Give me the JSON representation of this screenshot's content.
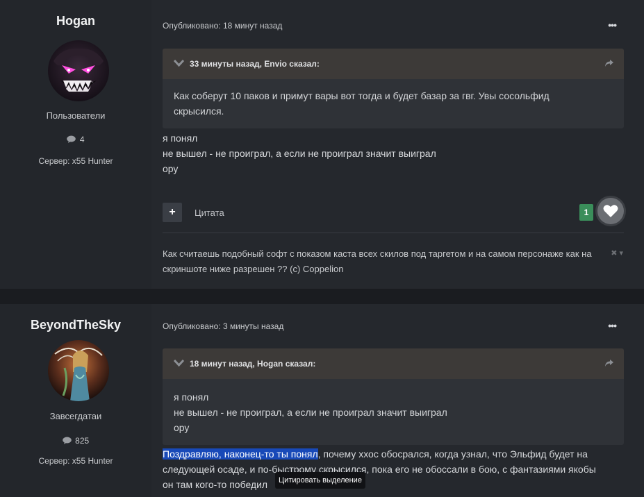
{
  "posts": [
    {
      "author": {
        "name": "Hogan",
        "group": "Пользователи",
        "post_count": "4",
        "server": "Сервер: x55 Hunter",
        "avatar_icon": "demon-grin-avatar"
      },
      "published": "Опубликовано: 18 минут назад",
      "menu_label": "•••",
      "quote": {
        "title": "33 минуты назад, Envio сказал:",
        "lines": [
          "Как соберут 10 паков и примут вары вот тогда и будет базар за гвг. Увы сосольфид",
          "скрысился."
        ]
      },
      "content_lines": [
        "я понял",
        "не вышел - не проиграл, а если не проиграл значит выиграл",
        "ору"
      ],
      "actions": {
        "plus_label": "+",
        "quote_label": "Цитата",
        "reaction_count": "1"
      },
      "signature": [
        "Как считаешь подобный софт с показом каста всех скилов под таргетом и на самом персонаже как на",
        "скриншоте ниже разрешен ?? (c) Coppelion"
      ],
      "signature_controls": "✖ ▾"
    },
    {
      "author": {
        "name": "BeyondTheSky",
        "group": "Завсегдатаи",
        "post_count": "825",
        "server": "Сервер: x55 Hunter",
        "avatar_icon": "fantasy-woman-avatar"
      },
      "published": "Опубликовано: 3 минуты назад",
      "menu_label": "•••",
      "quote": {
        "title": "18 минут назад, Hogan сказал:",
        "lines": [
          "я понял",
          "не вышел - не проиграл, а если не проиграл значит выиграл",
          "ору"
        ]
      },
      "content": {
        "highlighted": "Поздравляю, наконец-то ты понял",
        "line1_rest": ", почему ххос обосрался, когда узнал, что Эльфид будет на",
        "line2": "следующей осаде, и по-быстрому скрысился, пока его не обоссали в бою, с фантазиями якобы",
        "line3": "он там кого-то победил"
      }
    }
  ],
  "tooltip": "Цитировать выделение",
  "colors": {
    "background": "#1e2024",
    "post_bg": "#25282d",
    "quote_header": "#3d3a38",
    "selection": "#1849b8",
    "reaction_green": "#3a8e5a"
  }
}
